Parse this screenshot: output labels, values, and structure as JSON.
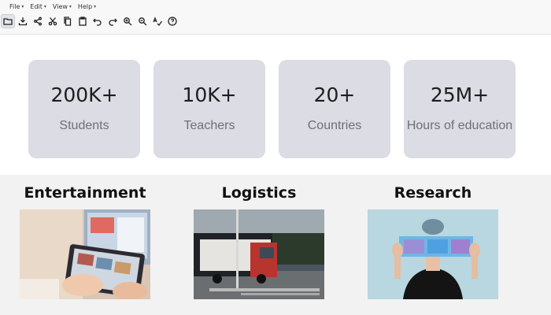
{
  "menu": [
    {
      "label": "File"
    },
    {
      "label": "Edit"
    },
    {
      "label": "View"
    },
    {
      "label": "Help"
    }
  ],
  "toolbar": [
    "open-folder-icon",
    "download-icon",
    "share-icon",
    "cut-icon",
    "copy-icon",
    "paste-icon",
    "undo-icon",
    "redo-icon",
    "zoom-in-icon",
    "zoom-out-icon",
    "spellcheck-icon",
    "help-icon"
  ],
  "stats": [
    {
      "value": "200K+",
      "label": "Students"
    },
    {
      "value": "10K+",
      "label": "Teachers"
    },
    {
      "value": "20+",
      "label": "Countries"
    },
    {
      "value": "25M+",
      "label": "Hours of education"
    }
  ],
  "categories": [
    {
      "title": "Entertainment"
    },
    {
      "title": "Logistics"
    },
    {
      "title": "Research"
    }
  ]
}
